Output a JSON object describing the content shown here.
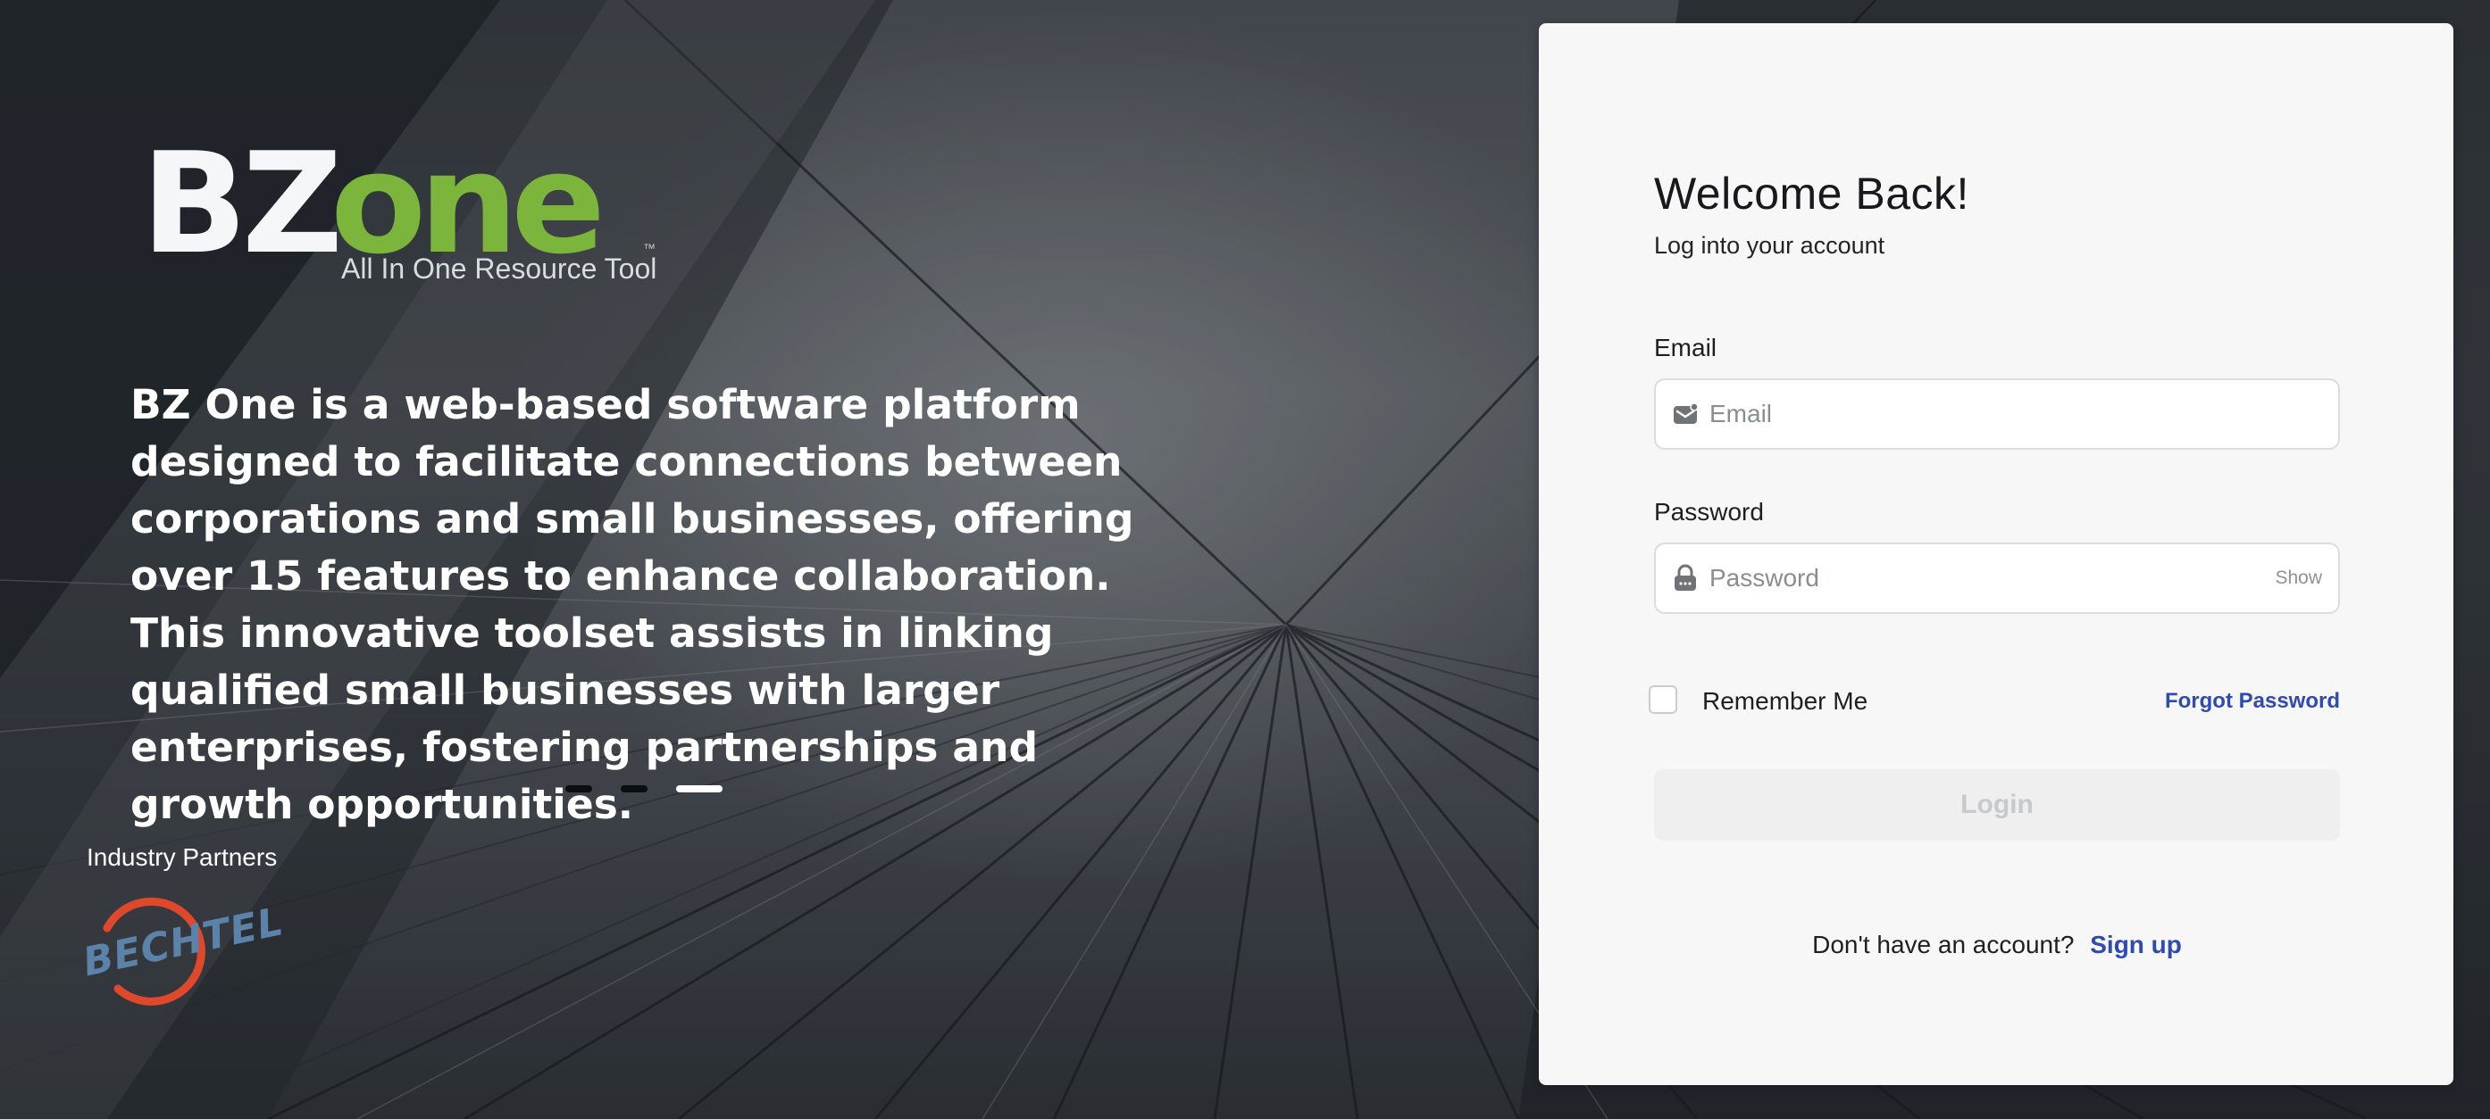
{
  "brand": {
    "logo_left": "BZ",
    "logo_right": "one",
    "trademark": "™",
    "tagline": "All In One Resource Tool",
    "accent_color": "#7cb53c"
  },
  "hero": {
    "description": "BZ One is a web-based software platform designed to facilitate connections between corporations and small businesses, offering over 15 features to enhance collaboration. This innovative toolset assists in linking qualified small businesses with larger enterprises, fostering partnerships and growth opportunities.",
    "carousel": {
      "slides": 3,
      "active_index": 2
    }
  },
  "partners": {
    "label": "Industry Partners",
    "logos": [
      {
        "name": "BECHTEL",
        "icon": "bechtel-logo"
      }
    ]
  },
  "login": {
    "title": "Welcome Back!",
    "subtitle": "Log into your account",
    "email": {
      "label": "Email",
      "placeholder": "Email",
      "value": "",
      "icon": "mail-icon"
    },
    "password": {
      "label": "Password",
      "placeholder": "Password",
      "value": "",
      "icon": "lock-icon",
      "toggle_label": "Show"
    },
    "remember_me": {
      "label": "Remember Me",
      "checked": false
    },
    "forgot_password": "Forgot Password",
    "submit_label": "Login",
    "signup_prompt": "Don't have an account?",
    "signup_link": "Sign up",
    "link_color": "#2f4ab0"
  }
}
